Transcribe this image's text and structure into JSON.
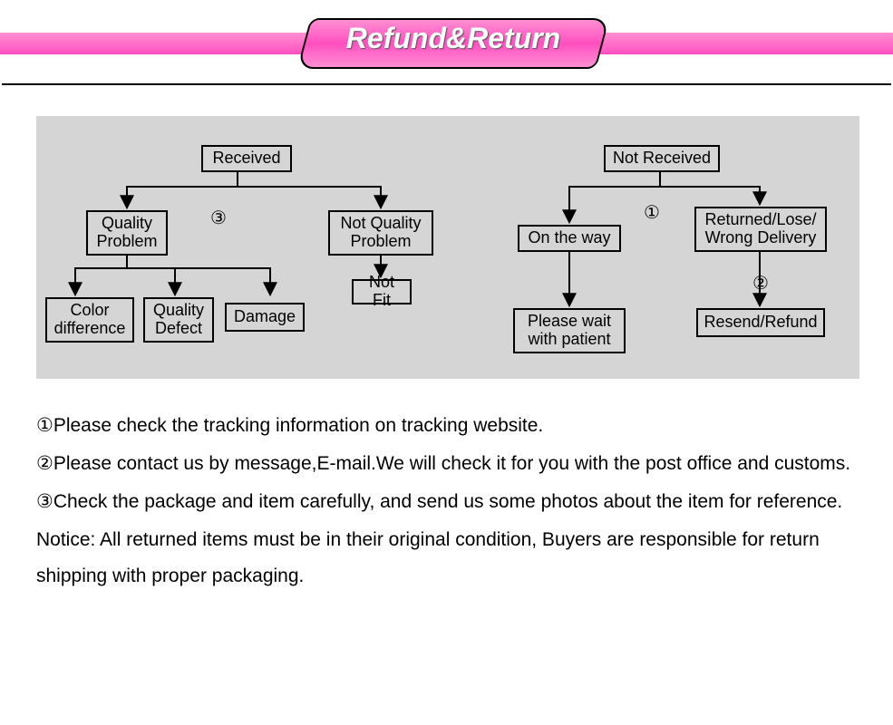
{
  "header": {
    "title": "Refund&Return"
  },
  "diagram": {
    "received": "Received",
    "notReceived": "Not Received",
    "qualityProblem": "Quality\nProblem",
    "notQualityProblem": "Not Quality\nProblem",
    "notFit": "Not Fit",
    "colorDifference": "Color\ndifference",
    "qualityDefect": "Quality\nDefect",
    "damage": "Damage",
    "onTheWay": "On the way",
    "returnedLose": "Returned/Lose/\nWrong Delivery",
    "pleaseWait": "Please wait\nwith patient",
    "resendRefund": "Resend/Refund",
    "marker1": "①",
    "marker2": "②",
    "marker3": "③"
  },
  "notes": {
    "line1": "①Please check the tracking information on tracking website.",
    "line2": "②Please contact us by message,E-mail.We will check it for you with the post office and customs.",
    "line3": "③Check the package and item carefully, and send us some photos about the item for reference.",
    "notice": "Notice: All returned items must be in their original condition, Buyers are responsible for return shipping with proper packaging."
  }
}
